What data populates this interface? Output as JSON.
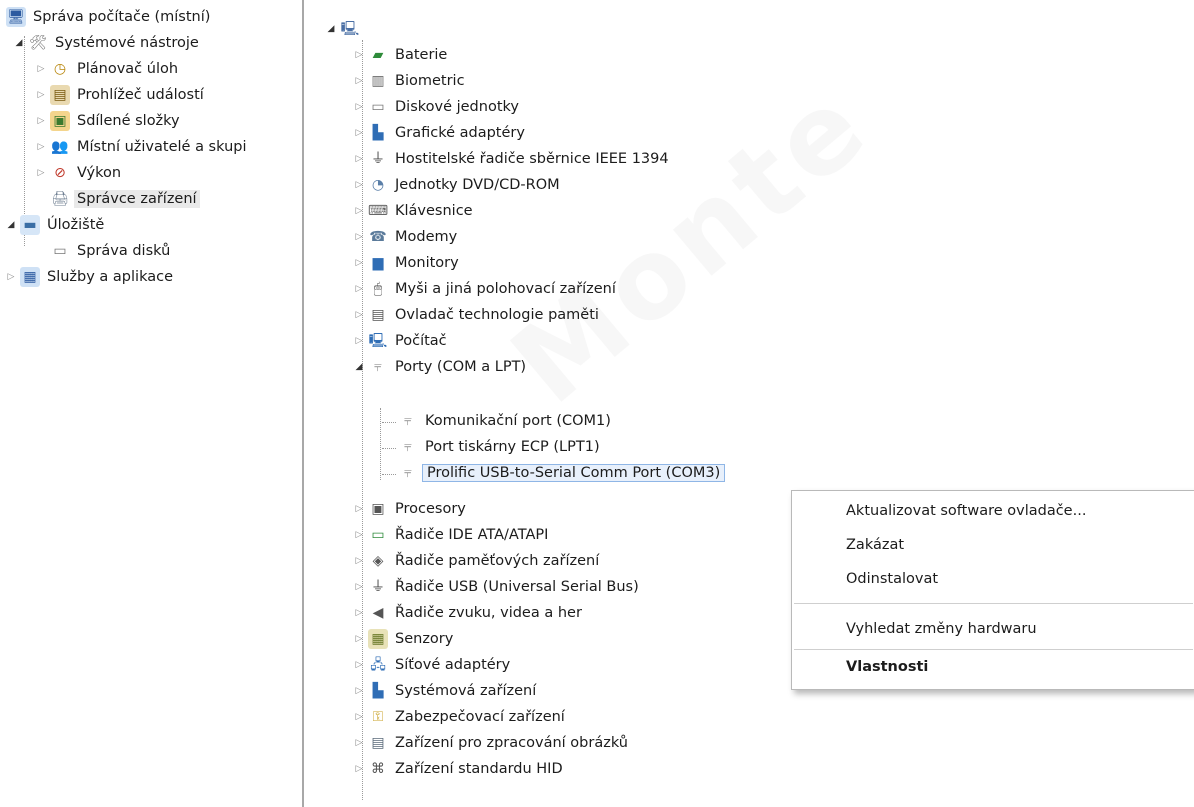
{
  "left_tree": {
    "root": {
      "label": "Správa počítače (místní)",
      "icon": "computer-management-icon"
    },
    "system_tools": {
      "label": "Systémové nástroje",
      "icon": "toolbox-icon"
    },
    "task_scheduler": {
      "label": "Plánovač úloh",
      "icon": "clock-icon"
    },
    "event_viewer": {
      "label": "Prohlížeč událostí",
      "icon": "event-viewer-icon"
    },
    "shared_folders": {
      "label": "Sdílené složky",
      "icon": "shared-folder-icon"
    },
    "local_users": {
      "label": "Místní uživatelé a skupi",
      "icon": "users-icon"
    },
    "performance": {
      "label": "Výkon",
      "icon": "performance-gauge-icon"
    },
    "device_manager": {
      "label": "Správce zařízení",
      "icon": "device-manager-icon"
    },
    "storage": {
      "label": "Úložiště",
      "icon": "storage-icon"
    },
    "disk_management": {
      "label": "Správa disků",
      "icon": "disk-icon"
    },
    "services": {
      "label": "Služby a aplikace",
      "icon": "services-icon"
    }
  },
  "device_tree": {
    "categories": [
      {
        "label": "Baterie",
        "icon": "battery-icon"
      },
      {
        "label": "Biometric",
        "icon": "fingerprint-icon"
      },
      {
        "label": "Diskové jednotky",
        "icon": "disk-drive-icon"
      },
      {
        "label": "Grafické adaptéry",
        "icon": "display-adapter-icon"
      },
      {
        "label": "Hostitelské řadiče sběrnice IEEE 1394",
        "icon": "ieee1394-icon"
      },
      {
        "label": "Jednotky DVD/CD-ROM",
        "icon": "dvd-drive-icon"
      },
      {
        "label": "Klávesnice",
        "icon": "keyboard-icon"
      },
      {
        "label": "Modemy",
        "icon": "modem-icon"
      },
      {
        "label": "Monitory",
        "icon": "monitor-icon"
      },
      {
        "label": "Myši a jiná polohovací zařízení",
        "icon": "mouse-icon"
      },
      {
        "label": "Ovladač technologie paměti",
        "icon": "memory-icon"
      },
      {
        "label": "Počítač",
        "icon": "computer-icon"
      },
      {
        "label": "Porty (COM a LPT)",
        "icon": "port-icon"
      },
      {
        "label": "Komunikační port (COM1)",
        "icon": "port-icon"
      },
      {
        "label": "Port tiskárny ECP (LPT1)",
        "icon": "port-icon"
      },
      {
        "label": "Prolific USB-to-Serial Comm Port (COM3)",
        "icon": "port-icon"
      },
      {
        "label": "Procesory",
        "icon": "processor-icon"
      },
      {
        "label": "Řadiče IDE ATA/ATAPI",
        "icon": "ide-controller-icon"
      },
      {
        "label": "Řadiče paměťových zařízení",
        "icon": "storage-controller-icon"
      },
      {
        "label": "Řadiče USB (Universal Serial Bus)",
        "icon": "usb-icon"
      },
      {
        "label": "Řadiče zvuku, videa a her",
        "icon": "speaker-icon"
      },
      {
        "label": "Senzory",
        "icon": "sensor-icon"
      },
      {
        "label": "Síťové adaptéry",
        "icon": "network-adapter-icon"
      },
      {
        "label": "Systémová zařízení",
        "icon": "system-device-icon"
      },
      {
        "label": "Zabezpečovací zařízení",
        "icon": "security-key-icon"
      },
      {
        "label": "Zařízení pro zpracování obrázků",
        "icon": "scanner-icon"
      },
      {
        "label": "Zařízení standardu HID",
        "icon": "hid-icon"
      }
    ]
  },
  "context_menu": {
    "update_driver": "Aktualizovat software ovladače...",
    "disable": "Zakázat",
    "uninstall": "Odinstalovat",
    "scan_changes": "Vyhledat změny hardwaru",
    "properties": "Vlastnosti"
  },
  "colors": {
    "selection": "#e8f0fb",
    "selection_border": "#8fb6e6",
    "divider": "#a8a8a8"
  }
}
